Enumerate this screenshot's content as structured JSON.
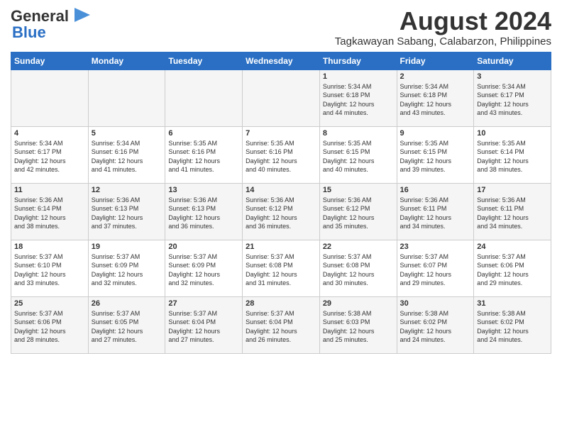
{
  "header": {
    "logo_line1": "General",
    "logo_line2": "Blue",
    "month_year": "August 2024",
    "location": "Tagkawayan Sabang, Calabarzon, Philippines"
  },
  "weekdays": [
    "Sunday",
    "Monday",
    "Tuesday",
    "Wednesday",
    "Thursday",
    "Friday",
    "Saturday"
  ],
  "weeks": [
    [
      {
        "num": "",
        "info": ""
      },
      {
        "num": "",
        "info": ""
      },
      {
        "num": "",
        "info": ""
      },
      {
        "num": "",
        "info": ""
      },
      {
        "num": "1",
        "info": "Sunrise: 5:34 AM\nSunset: 6:18 PM\nDaylight: 12 hours\nand 44 minutes."
      },
      {
        "num": "2",
        "info": "Sunrise: 5:34 AM\nSunset: 6:18 PM\nDaylight: 12 hours\nand 43 minutes."
      },
      {
        "num": "3",
        "info": "Sunrise: 5:34 AM\nSunset: 6:17 PM\nDaylight: 12 hours\nand 43 minutes."
      }
    ],
    [
      {
        "num": "4",
        "info": "Sunrise: 5:34 AM\nSunset: 6:17 PM\nDaylight: 12 hours\nand 42 minutes."
      },
      {
        "num": "5",
        "info": "Sunrise: 5:34 AM\nSunset: 6:16 PM\nDaylight: 12 hours\nand 41 minutes."
      },
      {
        "num": "6",
        "info": "Sunrise: 5:35 AM\nSunset: 6:16 PM\nDaylight: 12 hours\nand 41 minutes."
      },
      {
        "num": "7",
        "info": "Sunrise: 5:35 AM\nSunset: 6:16 PM\nDaylight: 12 hours\nand 40 minutes."
      },
      {
        "num": "8",
        "info": "Sunrise: 5:35 AM\nSunset: 6:15 PM\nDaylight: 12 hours\nand 40 minutes."
      },
      {
        "num": "9",
        "info": "Sunrise: 5:35 AM\nSunset: 6:15 PM\nDaylight: 12 hours\nand 39 minutes."
      },
      {
        "num": "10",
        "info": "Sunrise: 5:35 AM\nSunset: 6:14 PM\nDaylight: 12 hours\nand 38 minutes."
      }
    ],
    [
      {
        "num": "11",
        "info": "Sunrise: 5:36 AM\nSunset: 6:14 PM\nDaylight: 12 hours\nand 38 minutes."
      },
      {
        "num": "12",
        "info": "Sunrise: 5:36 AM\nSunset: 6:13 PM\nDaylight: 12 hours\nand 37 minutes."
      },
      {
        "num": "13",
        "info": "Sunrise: 5:36 AM\nSunset: 6:13 PM\nDaylight: 12 hours\nand 36 minutes."
      },
      {
        "num": "14",
        "info": "Sunrise: 5:36 AM\nSunset: 6:12 PM\nDaylight: 12 hours\nand 36 minutes."
      },
      {
        "num": "15",
        "info": "Sunrise: 5:36 AM\nSunset: 6:12 PM\nDaylight: 12 hours\nand 35 minutes."
      },
      {
        "num": "16",
        "info": "Sunrise: 5:36 AM\nSunset: 6:11 PM\nDaylight: 12 hours\nand 34 minutes."
      },
      {
        "num": "17",
        "info": "Sunrise: 5:36 AM\nSunset: 6:11 PM\nDaylight: 12 hours\nand 34 minutes."
      }
    ],
    [
      {
        "num": "18",
        "info": "Sunrise: 5:37 AM\nSunset: 6:10 PM\nDaylight: 12 hours\nand 33 minutes."
      },
      {
        "num": "19",
        "info": "Sunrise: 5:37 AM\nSunset: 6:09 PM\nDaylight: 12 hours\nand 32 minutes."
      },
      {
        "num": "20",
        "info": "Sunrise: 5:37 AM\nSunset: 6:09 PM\nDaylight: 12 hours\nand 32 minutes."
      },
      {
        "num": "21",
        "info": "Sunrise: 5:37 AM\nSunset: 6:08 PM\nDaylight: 12 hours\nand 31 minutes."
      },
      {
        "num": "22",
        "info": "Sunrise: 5:37 AM\nSunset: 6:08 PM\nDaylight: 12 hours\nand 30 minutes."
      },
      {
        "num": "23",
        "info": "Sunrise: 5:37 AM\nSunset: 6:07 PM\nDaylight: 12 hours\nand 29 minutes."
      },
      {
        "num": "24",
        "info": "Sunrise: 5:37 AM\nSunset: 6:06 PM\nDaylight: 12 hours\nand 29 minutes."
      }
    ],
    [
      {
        "num": "25",
        "info": "Sunrise: 5:37 AM\nSunset: 6:06 PM\nDaylight: 12 hours\nand 28 minutes."
      },
      {
        "num": "26",
        "info": "Sunrise: 5:37 AM\nSunset: 6:05 PM\nDaylight: 12 hours\nand 27 minutes."
      },
      {
        "num": "27",
        "info": "Sunrise: 5:37 AM\nSunset: 6:04 PM\nDaylight: 12 hours\nand 27 minutes."
      },
      {
        "num": "28",
        "info": "Sunrise: 5:37 AM\nSunset: 6:04 PM\nDaylight: 12 hours\nand 26 minutes."
      },
      {
        "num": "29",
        "info": "Sunrise: 5:38 AM\nSunset: 6:03 PM\nDaylight: 12 hours\nand 25 minutes."
      },
      {
        "num": "30",
        "info": "Sunrise: 5:38 AM\nSunset: 6:02 PM\nDaylight: 12 hours\nand 24 minutes."
      },
      {
        "num": "31",
        "info": "Sunrise: 5:38 AM\nSunset: 6:02 PM\nDaylight: 12 hours\nand 24 minutes."
      }
    ]
  ]
}
